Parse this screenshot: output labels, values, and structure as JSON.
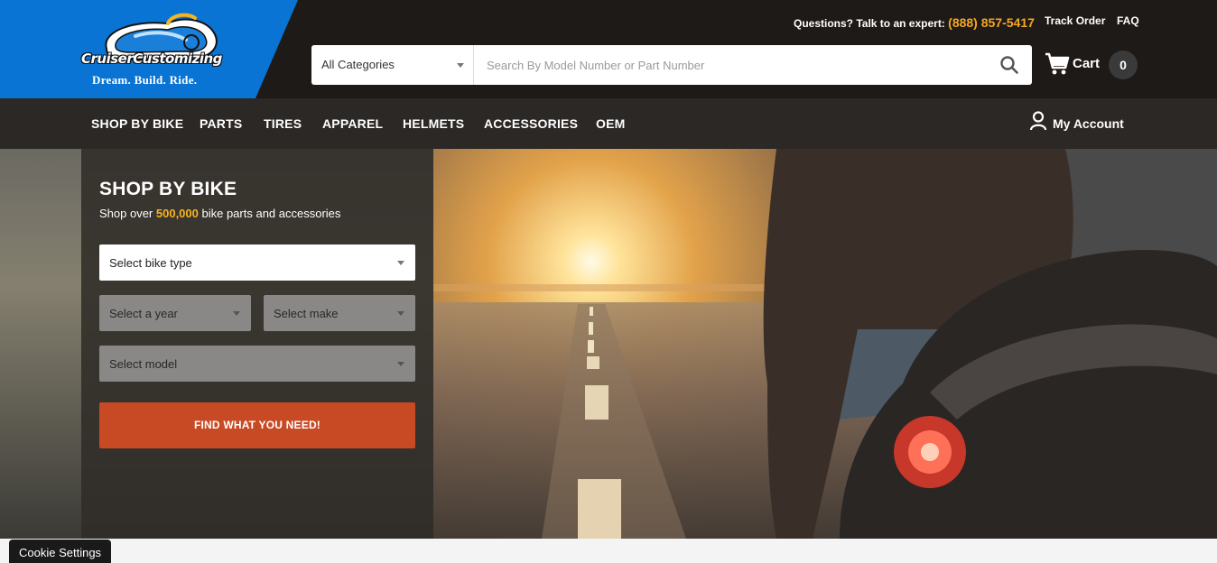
{
  "brand": {
    "logo_text": "CruiserCustomizing",
    "tagline": "Dream. Build. Ride.",
    "colors": {
      "logo_blue": "#0a74d4",
      "accent_orange": "#f5a623",
      "cta": "#c84a24",
      "header_bg": "#1e1a17"
    }
  },
  "utility": {
    "question_text": "Questions? Talk to an expert:",
    "phone": "(888) 857-5417",
    "track_order": "Track Order",
    "faq": "FAQ"
  },
  "search": {
    "category_value": "All Categories",
    "placeholder": "Search By Model Number or Part Number",
    "icon": "search-icon"
  },
  "cart": {
    "label": "Cart",
    "count": "0",
    "icon": "cart-icon"
  },
  "nav": {
    "items": [
      "SHOP BY BIKE",
      "PARTS",
      "TIRES",
      "APPAREL",
      "HELMETS",
      "ACCESSORIES",
      "OEM"
    ],
    "account_label": "My Account",
    "account_icon": "user-icon"
  },
  "finder": {
    "title": "SHOP BY BIKE",
    "subtitle_prefix": "Shop over ",
    "subtitle_highlight": "500,000",
    "subtitle_suffix": " bike parts and accessories",
    "bike_type": "Select bike type",
    "year": "Select a year",
    "make": "Select make",
    "model": "Select model",
    "button": "FIND WHAT YOU NEED!"
  },
  "cookie": {
    "label": "Cookie Settings"
  }
}
